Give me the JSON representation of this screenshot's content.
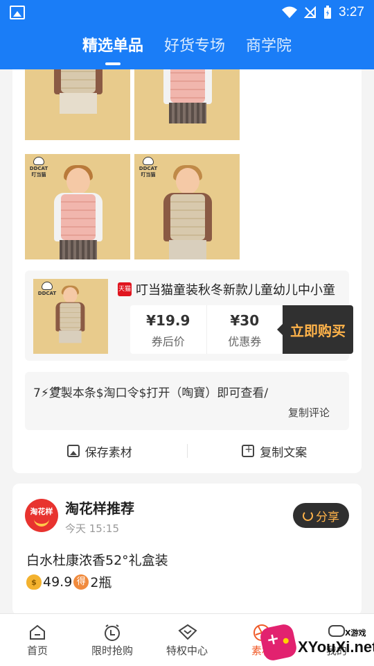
{
  "status_bar": {
    "time": "3:27"
  },
  "header": {
    "tabs": [
      {
        "label": "精选单品",
        "active": true
      },
      {
        "label": "好货专场",
        "active": false
      },
      {
        "label": "商学院",
        "active": false
      }
    ],
    "color": "#1a7df7"
  },
  "gallery": {
    "brand_mark": "DDCAT",
    "brand_mark_cn": "叮当猫"
  },
  "product": {
    "platform_badge": "天猫",
    "title": "叮当猫童装秋冬新款儿童幼儿中小童",
    "coupon_price": "¥19.9",
    "coupon_price_label": "券后价",
    "coupon_value": "¥30",
    "coupon_value_label": "优惠券",
    "buy_label": "立即购买"
  },
  "comment": {
    "text": "7⚡复໊製本条$淘口令$打开（啕寶）即可查看/",
    "copy_label": "复制评论"
  },
  "actions": {
    "save_label": "保存素材",
    "copy_label": "复制文案"
  },
  "post": {
    "avatar_text": "淘花样",
    "author": "淘花样推荐",
    "time": "今天 15:15",
    "share_label": "分享",
    "line1": "白水杜康浓香52°礼盒装",
    "price": "49.9",
    "de_badge": "得",
    "quantity": "2瓶"
  },
  "bottom_nav": [
    {
      "label": "首页",
      "icon": "home-icon"
    },
    {
      "label": "限时抢购",
      "icon": "clock-icon"
    },
    {
      "label": "特权中心",
      "icon": "diamond-icon"
    },
    {
      "label": "素材",
      "icon": "aperture-icon",
      "active": true
    },
    {
      "label": "我的",
      "icon": "chat-icon"
    }
  ],
  "watermark": {
    "text": "XYouXi.net",
    "small": "X游戏"
  },
  "colors": {
    "accent": "#1a7df7",
    "buy_text": "#ffb34a",
    "active_nav": "#f05a28"
  }
}
